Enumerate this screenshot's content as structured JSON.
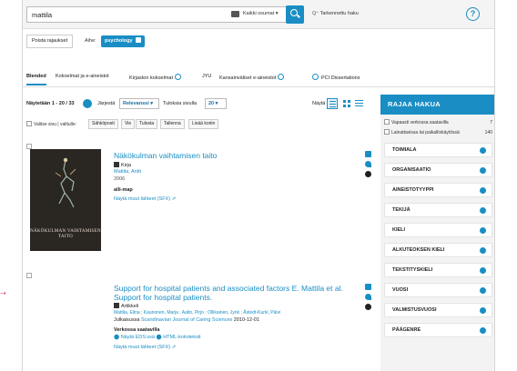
{
  "search": {
    "query": "mattila",
    "scope": "Kaikki osumat ▾",
    "advanced": "Tarkennettu haku"
  },
  "filters": {
    "clear": "Poista rajaukset",
    "subject_label": "Aihe:",
    "subject_value": "psychology"
  },
  "tabs": [
    {
      "label": "Blended"
    },
    {
      "label": "Kokoelmat ja e-aineistot"
    },
    {
      "label": "Kirjaston kokoelmat"
    },
    {
      "label": "JYU"
    },
    {
      "label": "Kansainväliset e-aineistot"
    },
    {
      "label": "PCI Dissertations"
    }
  ],
  "toolbar": {
    "results": "Näytetään 1 - 20 / 33",
    "sort_label": "Järjestä",
    "sort_value": "Relevanssi ▾",
    "perpage_label": "Tuloksia sivulla",
    "perpage_value": "20 ▾",
    "view_label": "Näytä"
  },
  "actions": {
    "select_all": "Valitse sivu | valitulle:",
    "buttons": [
      "Sähköposti",
      "Vie",
      "Tulosta",
      "Tallenna",
      "Lisää koriin"
    ]
  },
  "results": [
    {
      "title": "Näkökulman vaihtamisen taito",
      "type": "Kirja",
      "author": "Mattila, Antti",
      "year": "2006",
      "source": "alli-map",
      "link": "Näytä muut lähteet (SFX)",
      "cover_text": "NÄKÖKULMAN VAIHTAMISEN TAITO"
    },
    {
      "title": "Support for hospital patients and associated factors E. Mattila et al. Support for hospital patients.",
      "type": "Artikkeli",
      "authors": "Mattila, Elina ; Kaunonen, Marja ; Aalto, Pirjo ; Ollikainen, Jyrki ; Åstedt-Kurki, Päivi",
      "journal_prefix": "Julkaisussa",
      "journal": "Scandinavian Journal of Caring Sciences",
      "date": "2010-12-01",
      "availability": "Verkossa saatavilla",
      "link1": "Näytä EDS:ssä",
      "link2": "HTML-kokoteksti",
      "link3": "Näytä muut lähteet (SFX)"
    }
  ],
  "facets": {
    "header": "RAJAA HAKUA",
    "checks": [
      {
        "label": "Vapaasti verkossa saatavilla",
        "count": "7"
      },
      {
        "label": "Lainattavissa tai paikalliskäytössä",
        "count": "140"
      }
    ],
    "groups": [
      "TOIMIALA",
      "ORGANISAATIO",
      "AINEISTOTYYPPI",
      "TEKIJÄ",
      "KIELI",
      "ALKUTEOKSEN KIELI",
      "TEKSTITYSKIELI",
      "VUOSI",
      "VALMISTUSVUOSI",
      "PÄÄGENRE"
    ]
  },
  "colors": {
    "accent": "#1a8ec4"
  }
}
